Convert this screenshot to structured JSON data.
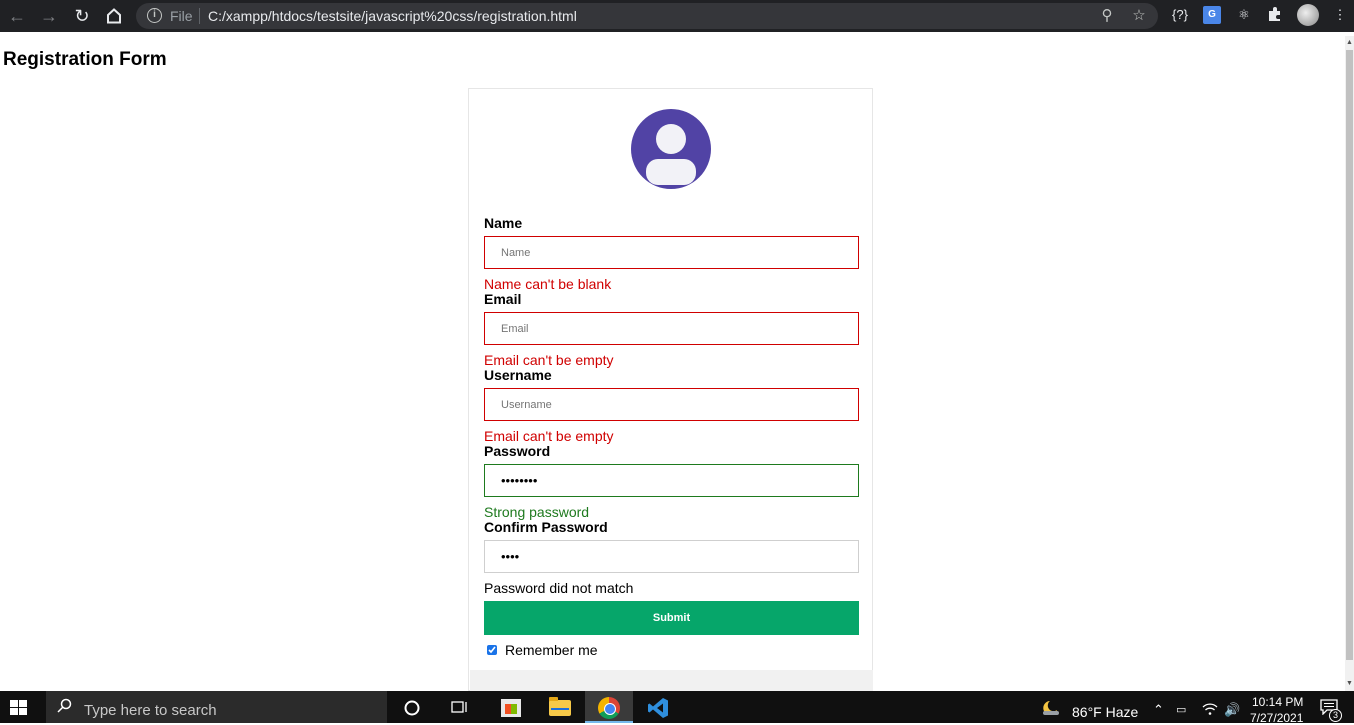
{
  "browser": {
    "back_icon": "arrow-left-icon",
    "forward_icon": "arrow-right-icon",
    "reload_icon": "reload-icon",
    "home_icon": "home-icon",
    "file_label": "File",
    "url": "C:/xampp/htdocs/testsite/javascript%20css/registration.html",
    "extension_label": "{?}",
    "translate_label": "G"
  },
  "page": {
    "heading": "Registration Form"
  },
  "form": {
    "avatar_icon": "user-avatar-icon",
    "fields": [
      {
        "label": "Name",
        "placeholder": "Name",
        "value": "",
        "message": "Name can't be blank",
        "state": "error"
      },
      {
        "label": "Email",
        "placeholder": "Email",
        "value": "",
        "message": "Email can't be empty",
        "state": "error"
      },
      {
        "label": "Username",
        "placeholder": "Username",
        "value": "",
        "message": "Email can't be empty",
        "state": "error"
      },
      {
        "label": "Password",
        "placeholder": "",
        "value": "••••••••",
        "message": "Strong password",
        "state": "success"
      },
      {
        "label": "Confirm Password",
        "placeholder": "",
        "value": "••••",
        "message": "Password did not match",
        "state": "neutral"
      }
    ],
    "submit_label": "Submit",
    "remember_label": "Remember me",
    "remember_checked": true
  },
  "taskbar": {
    "search_placeholder": "Type here to search",
    "weather": "86°F  Haze",
    "time": "10:14 PM",
    "date": "7/27/2021",
    "notification_count": "3"
  },
  "colors": {
    "error": "#d00000",
    "success": "#1e7a1e",
    "submit_bg": "#06a66a",
    "avatar_bg": "#5143a5"
  }
}
